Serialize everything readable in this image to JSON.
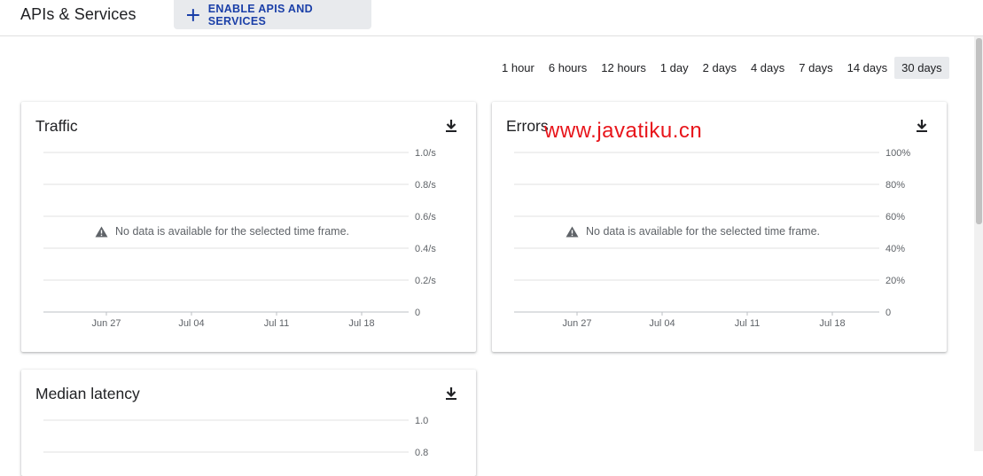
{
  "header": {
    "title": "APIs & Services",
    "enable_button_label": "ENABLE APIS AND SERVICES"
  },
  "time_range": {
    "options": [
      "1 hour",
      "6 hours",
      "12 hours",
      "1 day",
      "2 days",
      "4 days",
      "7 days",
      "14 days",
      "30 days"
    ],
    "selected": "30 days"
  },
  "cards": {
    "traffic": {
      "title": "Traffic",
      "no_data": "No data is available for the selected time frame."
    },
    "errors": {
      "title": "Errors",
      "no_data": "No data is available for the selected time frame."
    },
    "latency": {
      "title": "Median latency"
    }
  },
  "chart_data": [
    {
      "type": "line",
      "title": "Traffic",
      "x_ticks": [
        "Jun 27",
        "Jul 04",
        "Jul 11",
        "Jul 18"
      ],
      "y_ticks": [
        "1.0/s",
        "0.8/s",
        "0.6/s",
        "0.4/s",
        "0.2/s",
        "0"
      ],
      "ylim": [
        0,
        1.0
      ],
      "series": [],
      "grid": true
    },
    {
      "type": "line",
      "title": "Errors",
      "x_ticks": [
        "Jun 27",
        "Jul 04",
        "Jul 11",
        "Jul 18"
      ],
      "y_ticks": [
        "100%",
        "80%",
        "60%",
        "40%",
        "20%",
        "0"
      ],
      "ylim": [
        0,
        100
      ],
      "series": [],
      "grid": true
    },
    {
      "type": "line",
      "title": "Median latency",
      "x_ticks": [],
      "y_ticks": [
        "1.0",
        "0.8"
      ],
      "ylim": [
        0,
        1.0
      ],
      "series": [],
      "grid": true
    }
  ],
  "watermark": "www.javatiku.cn",
  "colors": {
    "accent": "#1a3fa8",
    "selected_bg": "#e8eaed",
    "grid": "#e0e0e0",
    "tick_text": "#5f6368",
    "watermark": "#e8151b"
  }
}
